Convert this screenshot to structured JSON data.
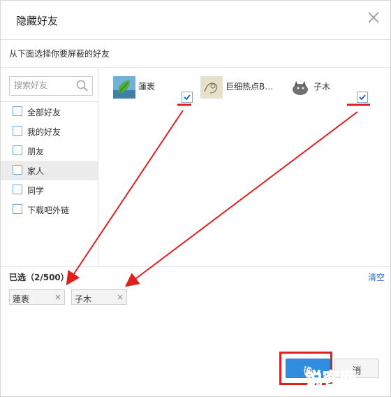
{
  "dialog": {
    "title": "隐藏好友",
    "subtitle": "从下面选择你要屏蔽的好友"
  },
  "search": {
    "placeholder": "搜索好友"
  },
  "groups": [
    {
      "label": "全部好友"
    },
    {
      "label": "我的好友"
    },
    {
      "label": "朋友"
    },
    {
      "label": "家人"
    },
    {
      "label": "同学"
    },
    {
      "label": "下载吧外链"
    }
  ],
  "friends": [
    {
      "name": "蓮袠",
      "checked": true,
      "avatar": "leaf-avatar-icon"
    },
    {
      "name": "巨细热点B…",
      "checked": false,
      "avatar": "sketch-avatar-icon"
    },
    {
      "name": "子木",
      "checked": true,
      "avatar": "cat-avatar-icon"
    }
  ],
  "selection": {
    "label": "已选（2/500）",
    "clear": "清空",
    "tags": [
      {
        "text": "蓮袠",
        "remove": "×"
      },
      {
        "text": "子木",
        "remove": "×"
      }
    ]
  },
  "buttons": {
    "ok": "确",
    "cancel": "消"
  },
  "watermark": "锐客网",
  "colors": {
    "accent": "#2f8fde",
    "annotation": "#e02020"
  }
}
